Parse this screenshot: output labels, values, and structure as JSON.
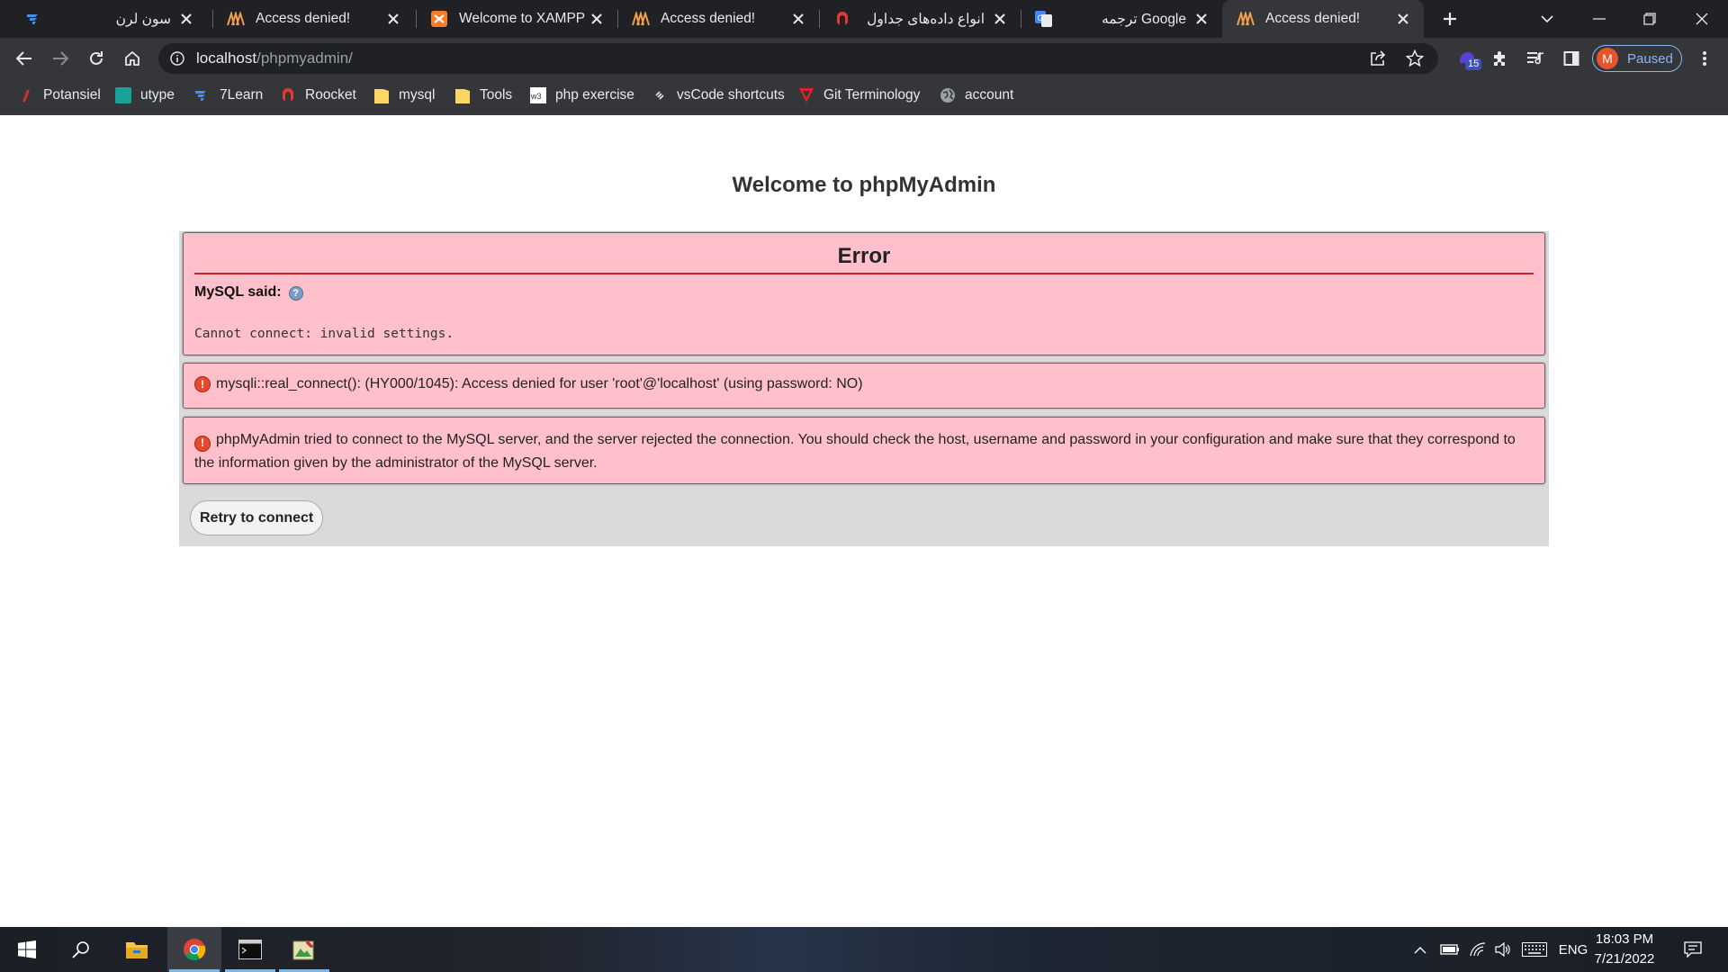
{
  "browser": {
    "tabs": [
      {
        "title": "سون لرن",
        "rtl": true,
        "icon": "sevenlearn-icon"
      },
      {
        "title": "Access denied!",
        "rtl": false,
        "icon": "phpmyadmin-icon"
      },
      {
        "title": "Welcome to XAMPP",
        "rtl": false,
        "icon": "xampp-icon"
      },
      {
        "title": "Access denied!",
        "rtl": false,
        "icon": "phpmyadmin-icon"
      },
      {
        "title": "انواع داده‌های جداول",
        "rtl": true,
        "icon": "roocket-icon"
      },
      {
        "title": "Google ترجمه",
        "rtl": true,
        "icon": "google-translate-icon"
      },
      {
        "title": "Access denied!",
        "rtl": false,
        "icon": "phpmyadmin-icon",
        "active": true
      }
    ],
    "url_host": "localhost",
    "url_path": "/phpmyadmin/",
    "extension_badge": "15",
    "profile_initial": "M",
    "profile_status": "Paused",
    "bookmarks": [
      {
        "label": "Potansiel",
        "icon": "potansiel-icon"
      },
      {
        "label": "utype",
        "icon": "utype-icon"
      },
      {
        "label": "7Learn",
        "icon": "sevenlearn-icon"
      },
      {
        "label": "Roocket",
        "icon": "roocket-icon"
      },
      {
        "label": "mysql",
        "icon": "folder-icon"
      },
      {
        "label": "Tools",
        "icon": "folder-icon"
      },
      {
        "label": "php exercise",
        "icon": "w3schools-icon"
      },
      {
        "label": "vsCode shortcuts",
        "icon": "link-icon"
      },
      {
        "label": "Git Terminology",
        "icon": "git-icon"
      },
      {
        "label": "account",
        "icon": "globe-icon"
      }
    ]
  },
  "page": {
    "welcome": "Welcome to phpMyAdmin",
    "error_title": "Error",
    "mysql_said": "MySQL said:",
    "error_code": "Cannot connect: invalid settings.",
    "message_1": "mysqli::real_connect(): (HY000/1045): Access denied for user 'root'@'localhost' (using password: NO)",
    "message_2": "phpMyAdmin tried to connect to the MySQL server, and the server rejected the connection. You should check the host, username and password in your configuration and make sure that they correspond to the information given by the administrator of the MySQL server.",
    "retry_button": "Retry to connect"
  },
  "taskbar": {
    "apps": [
      "start-icon",
      "search-icon",
      "file-explorer-icon",
      "chrome-icon",
      "terminal-icon",
      "image-app-icon"
    ],
    "language": "ENG",
    "time": "18:03 PM",
    "date": "7/21/2022"
  },
  "colors": {
    "error_bg": "#ffc0cb",
    "error_rule": "#cc2222",
    "panel_bg": "#dadada",
    "chrome_dark": "#202124",
    "chrome_toolbar": "#35363a",
    "profile_accent": "#8ab4f8"
  }
}
